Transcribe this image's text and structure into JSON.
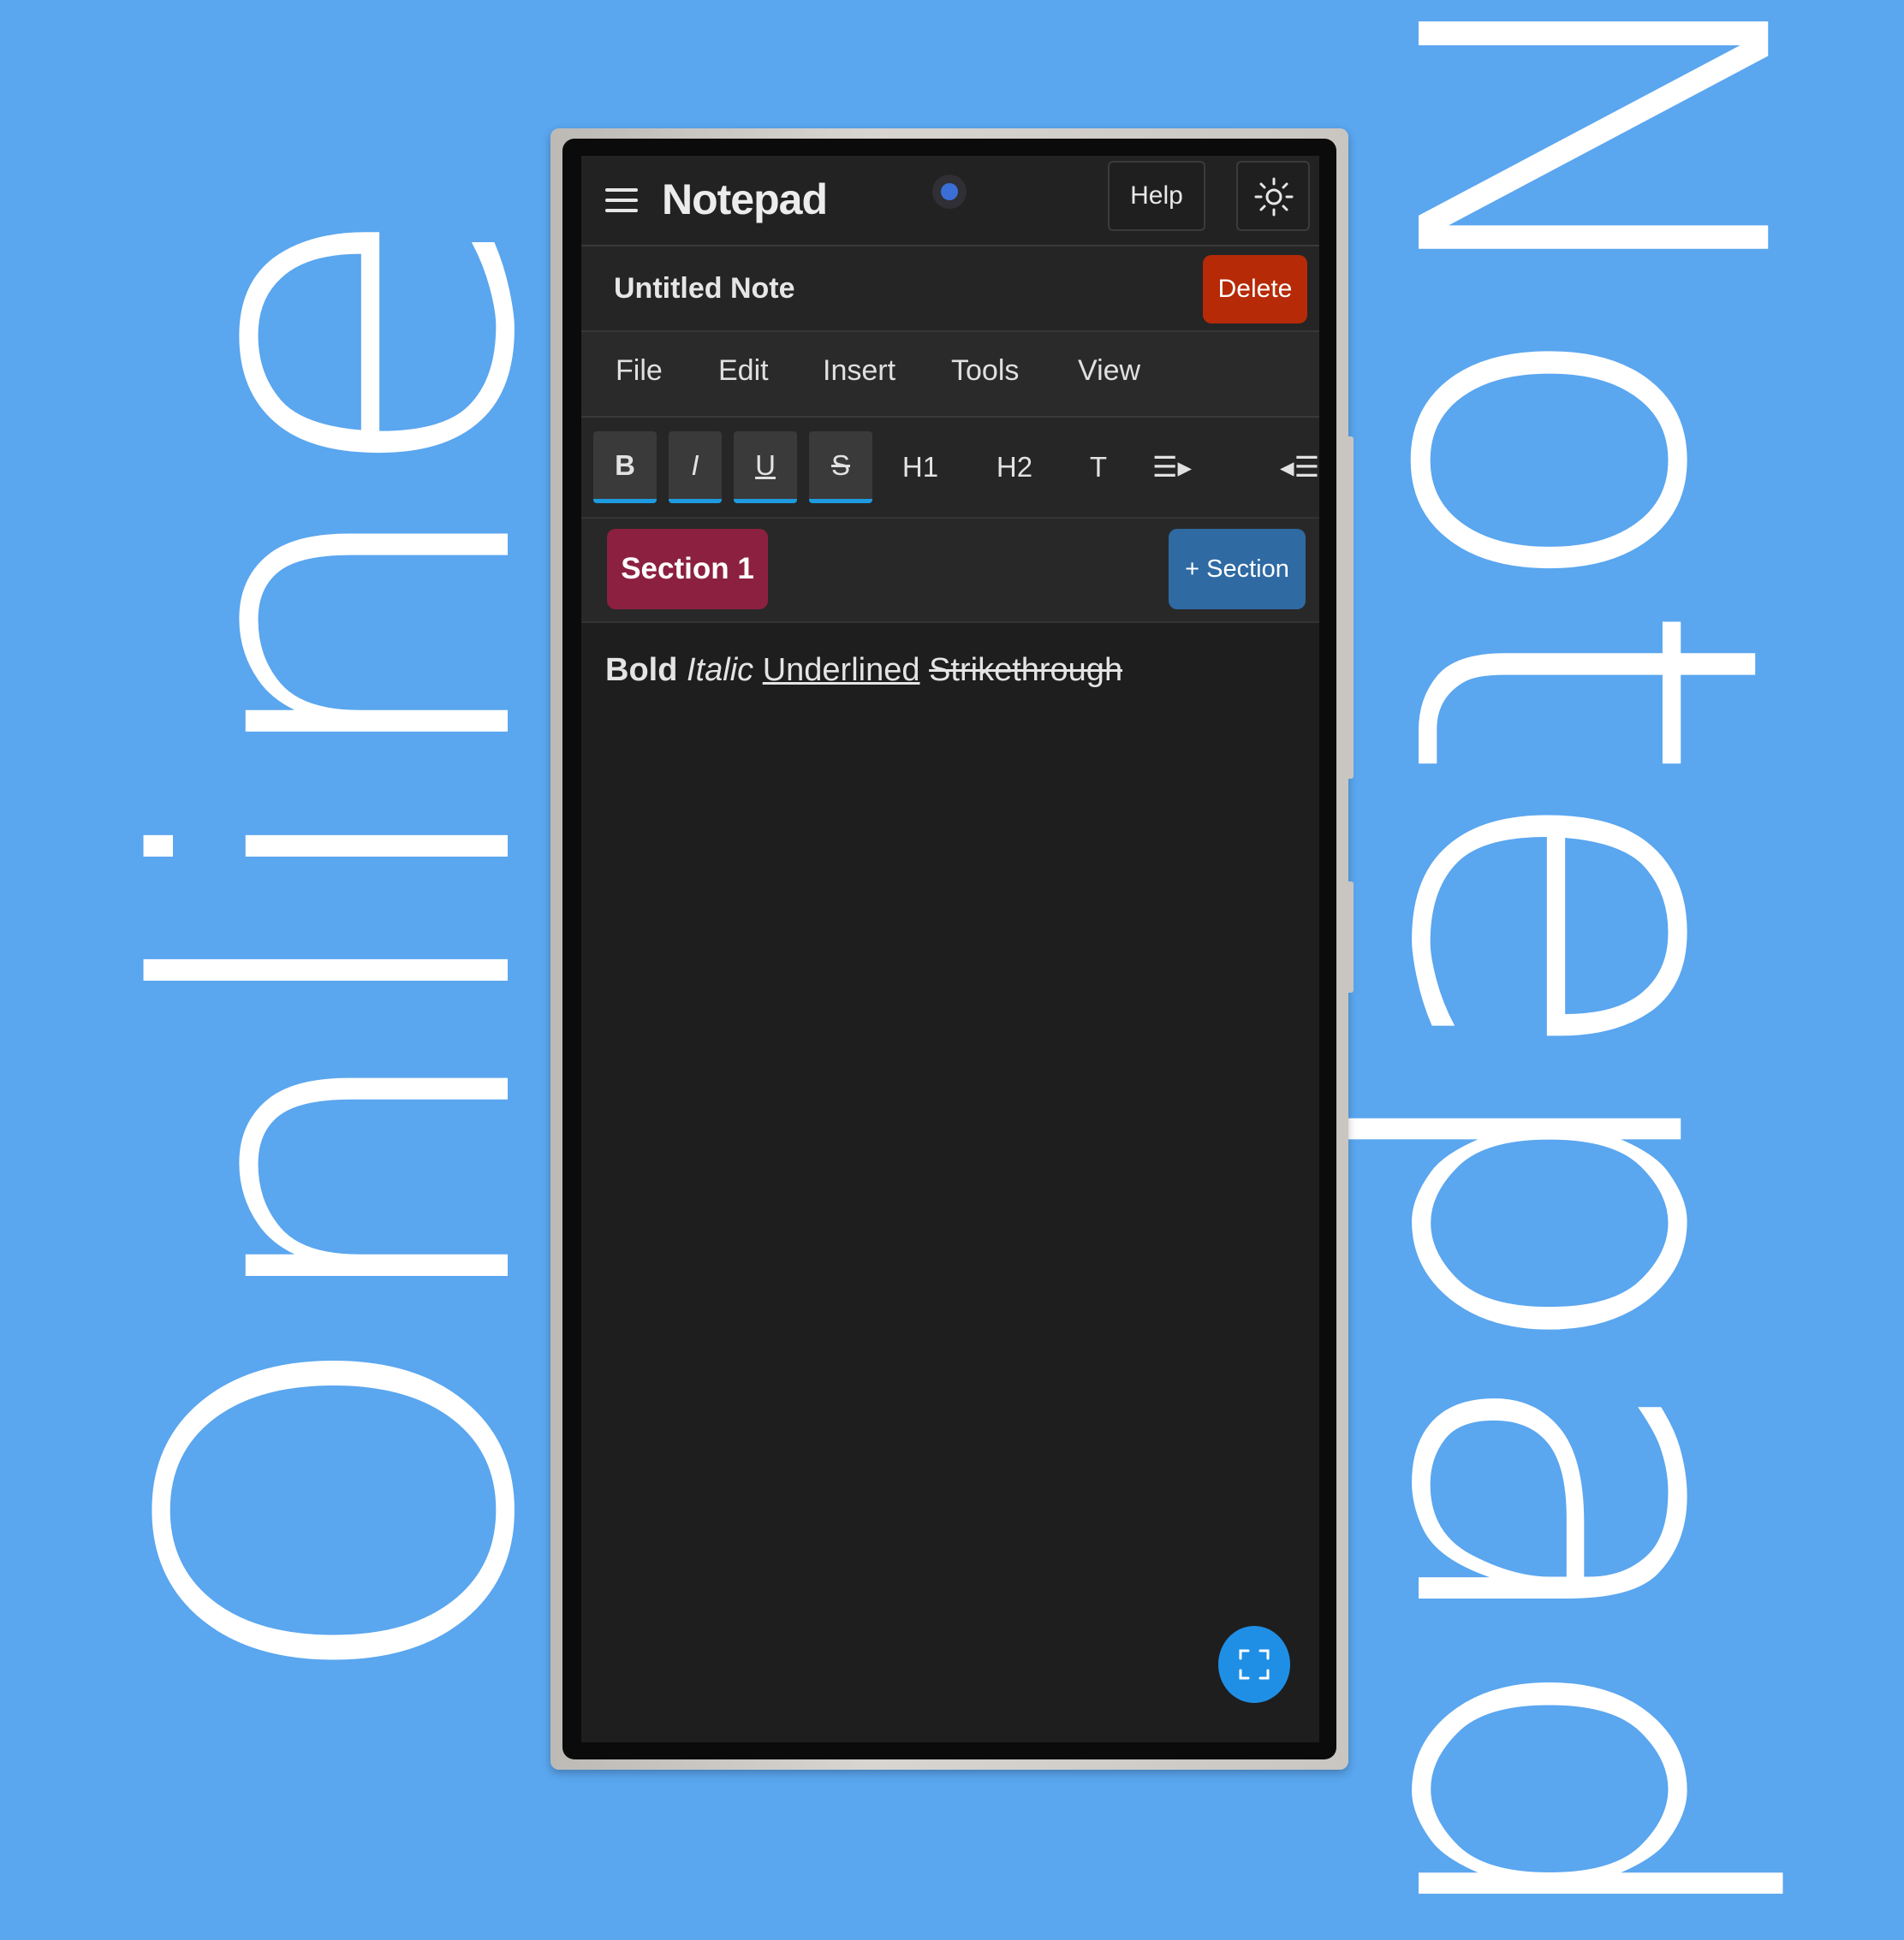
{
  "promo": {
    "left_text": "Online",
    "right_text": "Notepad"
  },
  "appbar": {
    "title": "Notepad",
    "help_label": "Help",
    "menu_icon": "hamburger-menu-icon",
    "theme_icon": "sun-icon"
  },
  "note": {
    "title": "Untitled Note",
    "delete_label": "Delete"
  },
  "menu": {
    "items": [
      "File",
      "Edit",
      "Insert",
      "Tools",
      "View"
    ]
  },
  "toolbar": {
    "bold": "B",
    "italic": "I",
    "underline": "U",
    "strike": "S",
    "h1": "H1",
    "h2": "H2",
    "text": "T",
    "indent": "☰▸",
    "outdent": "◂☰",
    "active_indicator_color": "#1e9be0"
  },
  "sections": {
    "active_tab": "Section 1",
    "add_label": "+ Section",
    "tab_color": "#8c2040",
    "add_color": "#2f6aa3"
  },
  "editor": {
    "bold_text": "Bold",
    "italic_text": "Italic",
    "underline_text": "Underlined",
    "strike_text": "Strikethrough"
  },
  "fab": {
    "icon": "fullscreen-icon",
    "color": "#1f8fe6"
  },
  "colors": {
    "background": "#5aa6ef",
    "delete": "#b62a07"
  }
}
